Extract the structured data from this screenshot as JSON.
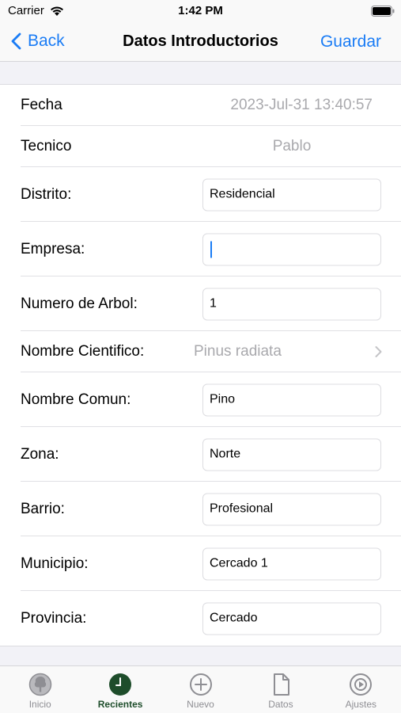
{
  "status": {
    "carrier": "Carrier",
    "time": "1:42 PM"
  },
  "nav": {
    "back_label": "Back",
    "title": "Datos Introductorios",
    "save_label": "Guardar"
  },
  "form": {
    "fecha": {
      "label": "Fecha",
      "value": "2023-Jul-31 13:40:57"
    },
    "tecnico": {
      "label": "Tecnico",
      "value": "Pablo"
    },
    "distrito": {
      "label": "Distrito:",
      "value": "Residencial"
    },
    "empresa": {
      "label": "Empresa:",
      "value": ""
    },
    "numero_arbol": {
      "label": "Numero de Arbol:",
      "value": "1"
    },
    "nombre_cientifico": {
      "label": "Nombre Cientifico:",
      "value": "Pinus radiata"
    },
    "nombre_comun": {
      "label": "Nombre Comun:",
      "value": "Pino"
    },
    "zona": {
      "label": "Zona:",
      "value": "Norte"
    },
    "barrio": {
      "label": "Barrio:",
      "value": "Profesional"
    },
    "municipio": {
      "label": "Municipio:",
      "value": "Cercado 1"
    },
    "provincia": {
      "label": "Provincia:",
      "value": "Cercado"
    }
  },
  "tabs": [
    {
      "label": "Inicio",
      "icon": "tree-icon",
      "active": false
    },
    {
      "label": "Recientes",
      "icon": "clock-icon",
      "active": true
    },
    {
      "label": "Nuevo",
      "icon": "plus-circle-icon",
      "active": false
    },
    {
      "label": "Datos",
      "icon": "document-icon",
      "active": false
    },
    {
      "label": "Ajustes",
      "icon": "settings-icon",
      "active": false
    }
  ],
  "colors": {
    "accent": "#1a7cf5",
    "tab_active": "#1e4d2b",
    "tab_inactive": "#8e8e93",
    "placeholder": "#a9a9ad"
  }
}
